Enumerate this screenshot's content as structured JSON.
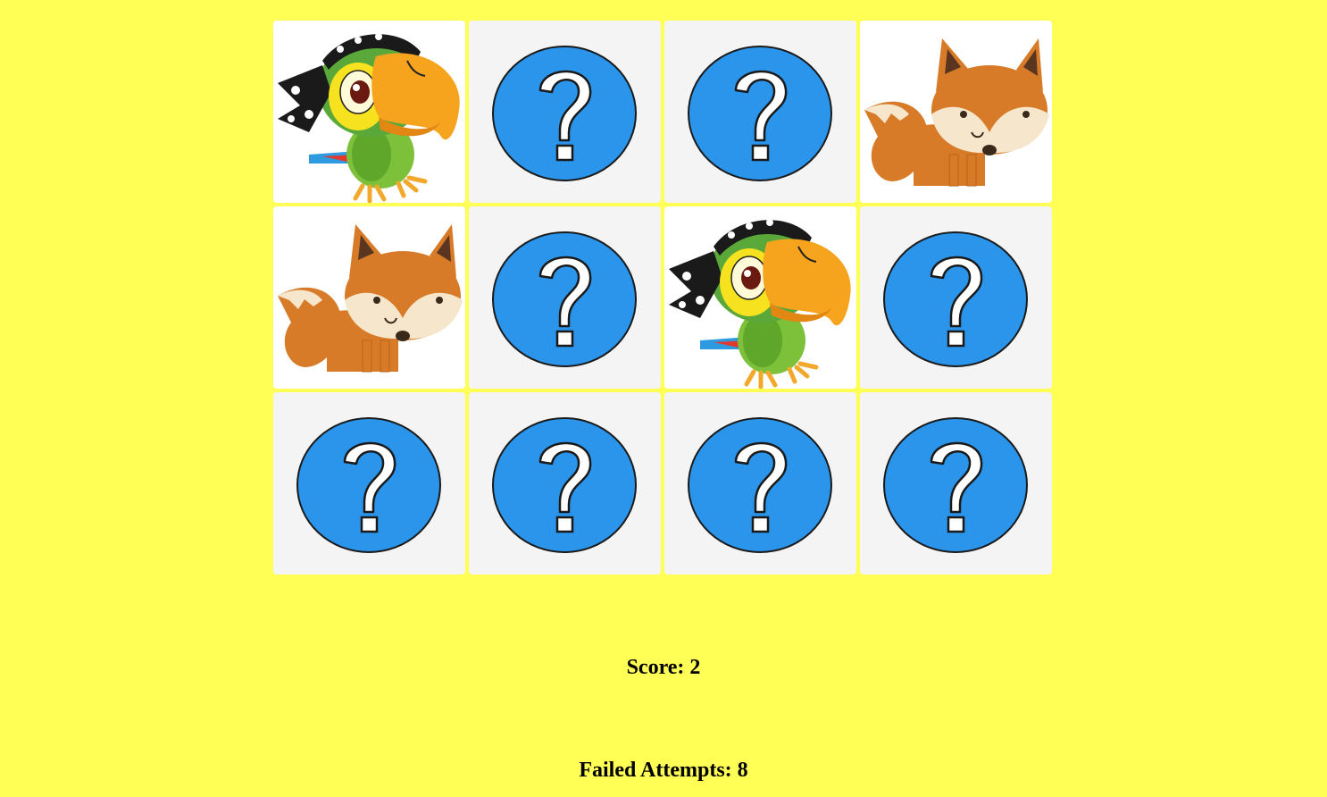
{
  "colors": {
    "page_background": "#ffff55",
    "hidden_card_background": "#f4f4f4",
    "revealed_card_background": "#ffffff",
    "question_circle": "#2b95ec"
  },
  "cards": [
    {
      "state": "revealed",
      "icon": "parrot-icon"
    },
    {
      "state": "hidden",
      "icon": "question-icon"
    },
    {
      "state": "hidden",
      "icon": "question-icon"
    },
    {
      "state": "revealed",
      "icon": "fox-icon"
    },
    {
      "state": "revealed",
      "icon": "fox-icon"
    },
    {
      "state": "hidden",
      "icon": "question-icon"
    },
    {
      "state": "revealed",
      "icon": "parrot-icon"
    },
    {
      "state": "hidden",
      "icon": "question-icon"
    },
    {
      "state": "hidden",
      "icon": "question-icon"
    },
    {
      "state": "hidden",
      "icon": "question-icon"
    },
    {
      "state": "hidden",
      "icon": "question-icon"
    },
    {
      "state": "hidden",
      "icon": "question-icon"
    }
  ],
  "stats": {
    "score_label": "Score: 2",
    "failed_label": "Failed Attempts: 8"
  }
}
